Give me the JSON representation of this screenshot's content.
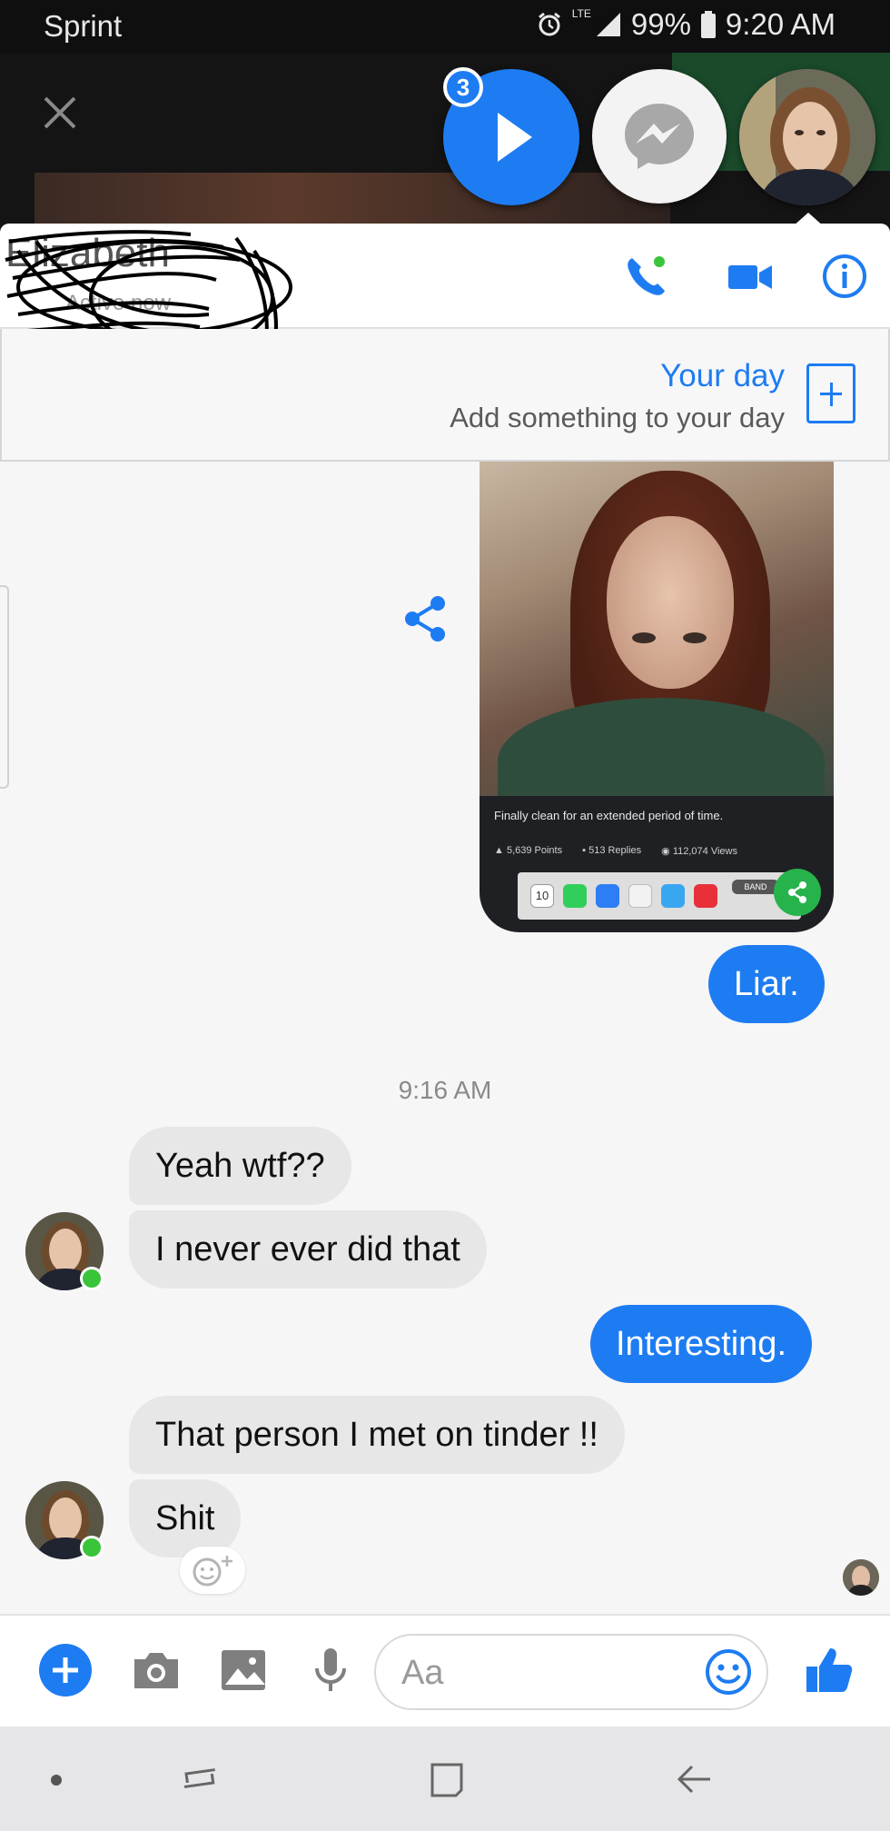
{
  "status_bar": {
    "carrier": "Sprint",
    "network": "LTE",
    "battery": "99%",
    "time": "9:20 AM"
  },
  "chat_heads": {
    "unread_badge": "3",
    "icons": [
      "close-icon",
      "play-icon",
      "messenger-icon",
      "contact-avatar"
    ]
  },
  "header": {
    "contact_name": "Elizabeth",
    "active_status": "Active now",
    "actions": [
      "phone-icon",
      "video-icon",
      "info-icon"
    ]
  },
  "your_day": {
    "title": "Your day",
    "subtitle": "Add something to your day"
  },
  "shared_post": {
    "caption": "Finally clean for an extended period of time.",
    "points": "5,639 Points",
    "replies": "513 Replies",
    "views": "112,074 Views",
    "dock_calendar_day": "10",
    "dock_app_label": "BAND"
  },
  "messages": [
    {
      "side": "out",
      "text": "Liar."
    },
    {
      "side": "timestamp",
      "text": "9:16 AM"
    },
    {
      "side": "in",
      "text": "Yeah wtf??"
    },
    {
      "side": "in",
      "text": "I never ever did that"
    },
    {
      "side": "out",
      "text": "Interesting."
    },
    {
      "side": "in",
      "text": "That person I met on tinder !!"
    },
    {
      "side": "in",
      "text": "Shit"
    }
  ],
  "composer": {
    "placeholder": "Aa",
    "icons": [
      "add-icon",
      "camera-icon",
      "gallery-icon",
      "microphone-icon",
      "emoji-icon",
      "thumbs-up-icon"
    ]
  },
  "colors": {
    "accent": "#1e7cf2",
    "incoming_bubble": "#e7e7e8",
    "online": "#3ac43a",
    "background": "#f6f6f7"
  }
}
